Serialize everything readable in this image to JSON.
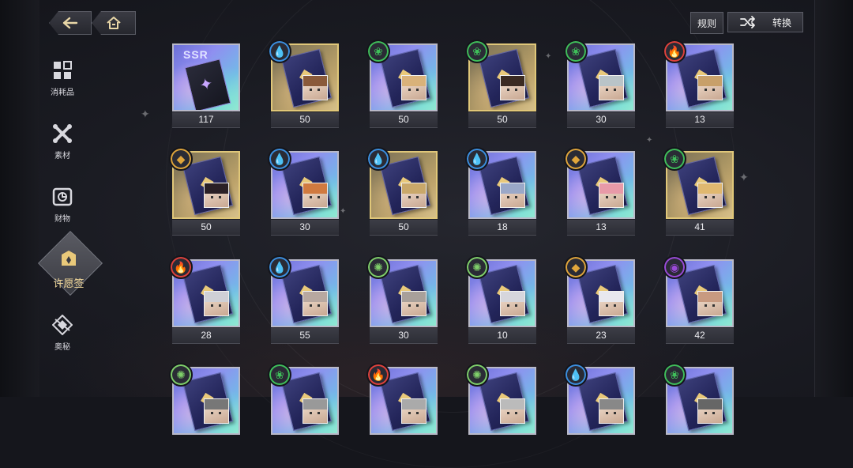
{
  "nav": {
    "back_icon": "back-arrow-icon",
    "home_icon": "home-icon"
  },
  "top_right": {
    "rules_label": "规则",
    "convert_label": "转换",
    "convert_icon": "shuffle-icon"
  },
  "sidebar": {
    "items": [
      {
        "label": "消耗品",
        "icon": "consumables-grid-icon"
      },
      {
        "label": "素材",
        "icon": "materials-cross-icon"
      },
      {
        "label": "财物",
        "icon": "wealth-safe-icon"
      },
      {
        "label": "许愿签",
        "icon": "wish-tag-icon",
        "active": true
      },
      {
        "label": "奥秘",
        "icon": "arcana-icon"
      }
    ]
  },
  "items": [
    {
      "count": "117",
      "type": "ssr",
      "ssr_label": "SSR",
      "frame": "silver",
      "element": "none"
    },
    {
      "count": "50",
      "frame": "gold",
      "element": "water"
    },
    {
      "count": "50",
      "frame": "silver",
      "element": "wind"
    },
    {
      "count": "50",
      "frame": "gold",
      "element": "wind"
    },
    {
      "count": "30",
      "frame": "silver",
      "element": "wind"
    },
    {
      "count": "13",
      "frame": "silver",
      "element": "fire"
    },
    {
      "count": "50",
      "frame": "gold",
      "element": "earth"
    },
    {
      "count": "30",
      "frame": "silver",
      "element": "water"
    },
    {
      "count": "50",
      "frame": "gold",
      "element": "water"
    },
    {
      "count": "18",
      "frame": "silver",
      "element": "water"
    },
    {
      "count": "13",
      "frame": "silver",
      "element": "earth"
    },
    {
      "count": "41",
      "frame": "gold",
      "element": "wind"
    },
    {
      "count": "28",
      "frame": "silver",
      "element": "fire"
    },
    {
      "count": "55",
      "frame": "silver",
      "element": "water"
    },
    {
      "count": "30",
      "frame": "silver",
      "element": "light"
    },
    {
      "count": "10",
      "frame": "silver",
      "element": "light"
    },
    {
      "count": "23",
      "frame": "silver",
      "element": "earth"
    },
    {
      "count": "42",
      "frame": "silver",
      "element": "dark"
    },
    {
      "count": "",
      "frame": "silver",
      "element": "light"
    },
    {
      "count": "",
      "frame": "silver",
      "element": "wind"
    },
    {
      "count": "",
      "frame": "silver",
      "element": "fire"
    },
    {
      "count": "",
      "frame": "silver",
      "element": "light"
    },
    {
      "count": "",
      "frame": "silver",
      "element": "water"
    },
    {
      "count": "",
      "frame": "silver",
      "element": "wind"
    }
  ],
  "colors": {
    "water": "#3b8fe0",
    "wind": "#3fbf5a",
    "fire": "#e0413b",
    "earth": "#e0a53b",
    "light": "#7fd06a",
    "dark": "#9a4ad8",
    "gold_frame": "#e0c779",
    "silver_frame": "#b9b9c8",
    "active_label": "#f2d89a"
  }
}
